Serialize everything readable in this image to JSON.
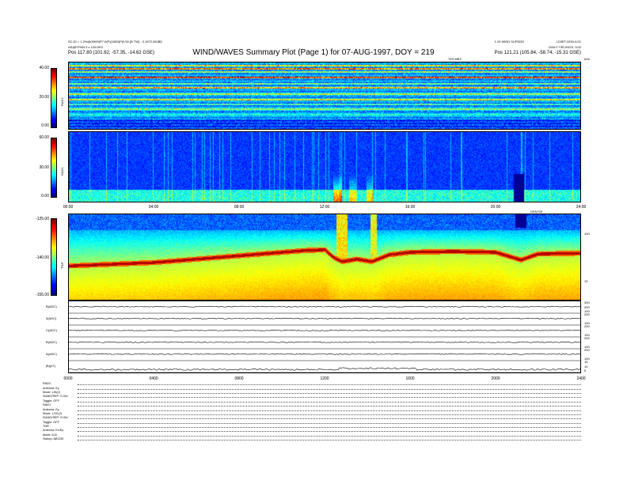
{
  "header": {
    "left_line1": "SC:DI = 1.2%@(9999)P7.0(P)(1083)P(0.50 [B TW] - 0.1972-95JB5",
    "left_line2": "AS@FF983.3 x 1D0.0E2",
    "left_line3": "Pos    117.80 (101.62, -57.35, -14.62 GSE)",
    "title": "WIND/WAVES Summary Plot (Page 1) for 07-AUG-1997, DOY = 219",
    "right_line1": "1.10 WIND SUPDDD",
    "right_line1b": "LD3ET-DDN-6.01",
    "right_line2": "DAILY  T9E:09/23, 3:02",
    "right_line3": "Pos    121.21 (105.84, -58.74, -15.31 GSE)",
    "top_time": "TE9 MB3",
    "top_unit": "kHz"
  },
  "colors": {
    "cmap": [
      "#000080",
      "#0000ff",
      "#0080ff",
      "#00ffff",
      "#80ff80",
      "#ffff00",
      "#ff8000",
      "#ff0000",
      "#800000"
    ]
  },
  "chart_data": [
    {
      "type": "heatmap",
      "name": "RAD2",
      "ylabel": "RAD2",
      "colorbar_ticks": [
        "40.00",
        "20.00",
        "0.00"
      ],
      "zlim": [
        0,
        40
      ],
      "xlim": [
        0,
        24
      ],
      "bands": [
        {
          "y": 0.04,
          "level": 0.72
        },
        {
          "y": 0.09,
          "level": 0.85
        },
        {
          "y": 0.14,
          "level": 0.6
        },
        {
          "y": 0.22,
          "level": 0.95
        },
        {
          "y": 0.31,
          "level": 0.55
        },
        {
          "y": 0.38,
          "level": 0.78
        },
        {
          "y": 0.47,
          "level": 0.65
        },
        {
          "y": 0.55,
          "level": 0.7
        },
        {
          "y": 0.62,
          "level": 0.5
        },
        {
          "y": 0.7,
          "level": 0.6
        },
        {
          "y": 0.78,
          "level": 0.45
        }
      ],
      "background_level": 0.28
    },
    {
      "type": "heatmap",
      "name": "RAD1",
      "ylabel": "RAD1",
      "colorbar_ticks": [
        "60.00",
        "30.00",
        "0.00"
      ],
      "zlim": [
        0,
        60
      ],
      "xlim": [
        0,
        24
      ],
      "background_level": 0.18,
      "bursts": [
        {
          "x": 12.6,
          "w": 0.4,
          "level": 0.75
        },
        {
          "x": 13.3,
          "w": 0.3,
          "level": 0.6
        },
        {
          "x": 14.1,
          "w": 0.3,
          "level": 0.55
        },
        {
          "x": 21.1,
          "w": 0.5,
          "level": 0.05
        }
      ]
    },
    {
      "type": "heatmap",
      "name": "TNR",
      "ylabel": "TNR",
      "colorbar_ticks": [
        "-125.00",
        "-140.00",
        "-155.00"
      ],
      "zlim": [
        -155,
        -125
      ],
      "xlim": [
        0,
        24
      ],
      "right_ticks": [
        "100",
        "10"
      ],
      "plasma_line": {
        "x": [
          0,
          2,
          4,
          6,
          8,
          10,
          11,
          12,
          12.4,
          12.8,
          13.5,
          14.2,
          15,
          16,
          18,
          20,
          20.8,
          21.2,
          22,
          24
        ],
        "y": [
          0.6,
          0.58,
          0.56,
          0.52,
          0.48,
          0.44,
          0.42,
          0.41,
          0.5,
          0.55,
          0.52,
          0.55,
          0.47,
          0.44,
          0.43,
          0.44,
          0.5,
          0.53,
          0.46,
          0.45
        ]
      },
      "bursts": [
        {
          "x": 12.8,
          "w": 0.5,
          "level": 0.9
        },
        {
          "x": 14.3,
          "w": 0.3,
          "level": 0.85
        },
        {
          "x": 21.2,
          "w": 0.5,
          "level": 0.1
        }
      ]
    },
    {
      "type": "line",
      "name": "Bx(nT)",
      "series": [
        {
          "name": "B(ADC)",
          "right_ticks": [
            "300",
            "200",
            "100"
          ]
        },
        {
          "name": "0(ADC)",
          "right_ticks": [
            "200",
            "100"
          ]
        },
        {
          "name": "C(ADC)",
          "right_ticks": [
            "200",
            "100"
          ]
        },
        {
          "name": "B(ADC)",
          "right_ticks": [
            "200",
            "100"
          ]
        },
        {
          "name": "A(ADC)",
          "right_ticks": [
            "200",
            "100"
          ]
        },
        {
          "name": "|B|(nT)",
          "right_ticks": [
            "15",
            "10",
            "5"
          ]
        }
      ]
    }
  ],
  "x_ticks_top": [
    "00:00",
    "04:00",
    "08:00",
    "12:00",
    "16:00",
    "20:00",
    "24:00"
  ],
  "x_ticks_mid": [
    "04:00",
    "08:00",
    "12:00",
    "16:00",
    "20:00"
  ],
  "x_ticks_bottom": [
    "0000",
    "0400",
    "0800",
    "1200",
    "1600",
    "2000",
    "2400"
  ],
  "mid_label": "DFAYSE",
  "info_rows": [
    {
      "k": "RAD2"
    },
    {
      "k": "Antenna:    Ey"
    },
    {
      "k": "Mode:       LIN(J)"
    },
    {
      "k": "SUMO/SEP:   S-Sel"
    },
    {
      "k": "Toggle:     OFF"
    },
    {
      "k": "RAD1"
    },
    {
      "k": "Antenna:    Ey"
    },
    {
      "k": "Mode:       LOG(J)"
    },
    {
      "k": "SUMO/SEP:   S-Sel"
    },
    {
      "k": "Toggle:     OFF"
    },
    {
      "k": "TNR"
    },
    {
      "k": "Antenna:    Ex/Ey"
    },
    {
      "k": "Mode:       A-B"
    },
    {
      "k": "Sweep:      ABCDE"
    }
  ]
}
